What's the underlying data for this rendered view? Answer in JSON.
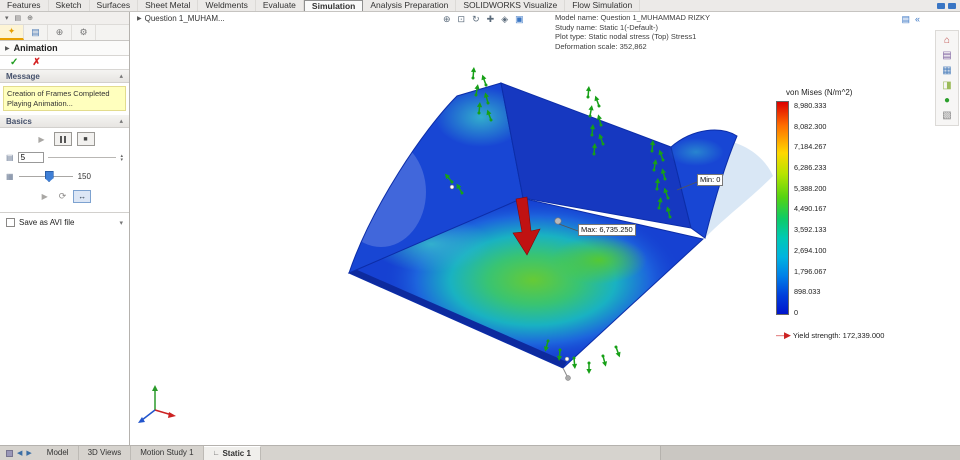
{
  "menu": {
    "tabs": [
      {
        "label": "Features"
      },
      {
        "label": "Sketch"
      },
      {
        "label": "Surfaces"
      },
      {
        "label": "Sheet Metal"
      },
      {
        "label": "Weldments"
      },
      {
        "label": "Evaluate"
      },
      {
        "label": "Simulation"
      },
      {
        "label": "Analysis Preparation"
      },
      {
        "label": "SOLIDWORKS Visualize"
      },
      {
        "label": "Flow Simulation"
      }
    ]
  },
  "property_manager": {
    "title": "Animation",
    "sections": {
      "message": "Message",
      "basics": "Basics"
    },
    "message_lines": [
      "Creation of Frames Completed",
      "Playing Animation..."
    ],
    "frames_value": "5",
    "speed_value": "150",
    "save_avi_label": "Save as AVI file"
  },
  "viewport": {
    "breadcrumb": "Question 1_MUHAM...",
    "info_lines": [
      "Model name: Question 1_MUHAMMAD RIZKY",
      "Study name: Static 1(-Default-)",
      "Plot type: Static nodal stress (Top) Stress1",
      "Deformation scale: 352,862"
    ],
    "max_label": "Max: 6,735.250",
    "min_label": "Min: 0"
  },
  "legend": {
    "title": "von Mises (N/m^2)",
    "ticks": [
      "8,980.333",
      "8,082.300",
      "7,184.267",
      "6,286.233",
      "5,388.200",
      "4,490.167",
      "3,592.133",
      "2,694.100",
      "1,796.067",
      "898.033",
      "0"
    ],
    "yield_label": "Yield strength: 172,339.000",
    "color_top": "#dc0000",
    "color_bottom": "#0014cc"
  },
  "status_bar": {
    "tabs": [
      {
        "label": "Model"
      },
      {
        "label": "3D Views"
      },
      {
        "label": "Motion Study 1"
      },
      {
        "label": "Static 1"
      }
    ]
  },
  "icons": {
    "play": "▶",
    "stop": "■",
    "check": "✓",
    "cross": "✗",
    "chevron_up": "▴",
    "chevron_down": "▾",
    "loop": "⟳",
    "range": "↔",
    "pm_tab_animation": "✦",
    "pm_tab_list": "▤",
    "pm_tab_target": "⊕",
    "pm_tab_gear": "⚙",
    "zoom_fit": "⊕",
    "zoom_area": "⊡",
    "rotate_view": "↻",
    "pan": "✚",
    "display_style": "◈",
    "view_cube": "▣",
    "display_pane": "«",
    "home": "⌂",
    "design_library": "▤",
    "file_explorer": "▦",
    "view_palette": "◨",
    "appearances": "●",
    "custom_properties": "▧",
    "prev": "◀",
    "next": "▶",
    "frame_icon": "▤",
    "key_icon": "▦",
    "yield_arrow": "—▶"
  }
}
